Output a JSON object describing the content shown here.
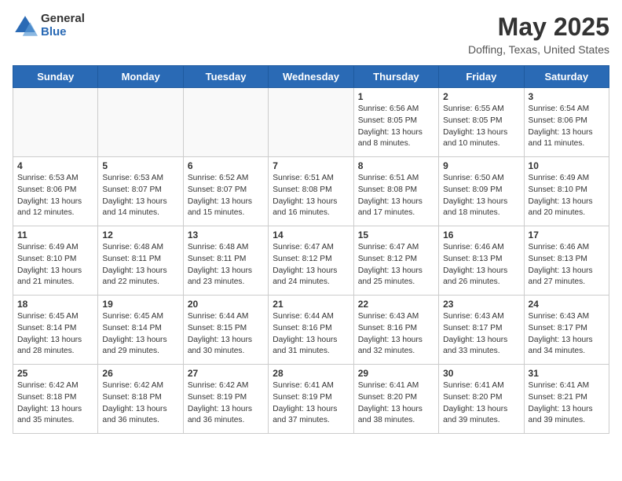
{
  "header": {
    "logo_general": "General",
    "logo_blue": "Blue",
    "month_year": "May 2025",
    "location": "Doffing, Texas, United States"
  },
  "days_of_week": [
    "Sunday",
    "Monday",
    "Tuesday",
    "Wednesday",
    "Thursday",
    "Friday",
    "Saturday"
  ],
  "weeks": [
    [
      {
        "day": "",
        "info": ""
      },
      {
        "day": "",
        "info": ""
      },
      {
        "day": "",
        "info": ""
      },
      {
        "day": "",
        "info": ""
      },
      {
        "day": "1",
        "info": "Sunrise: 6:56 AM\nSunset: 8:05 PM\nDaylight: 13 hours\nand 8 minutes."
      },
      {
        "day": "2",
        "info": "Sunrise: 6:55 AM\nSunset: 8:05 PM\nDaylight: 13 hours\nand 10 minutes."
      },
      {
        "day": "3",
        "info": "Sunrise: 6:54 AM\nSunset: 8:06 PM\nDaylight: 13 hours\nand 11 minutes."
      }
    ],
    [
      {
        "day": "4",
        "info": "Sunrise: 6:53 AM\nSunset: 8:06 PM\nDaylight: 13 hours\nand 12 minutes."
      },
      {
        "day": "5",
        "info": "Sunrise: 6:53 AM\nSunset: 8:07 PM\nDaylight: 13 hours\nand 14 minutes."
      },
      {
        "day": "6",
        "info": "Sunrise: 6:52 AM\nSunset: 8:07 PM\nDaylight: 13 hours\nand 15 minutes."
      },
      {
        "day": "7",
        "info": "Sunrise: 6:51 AM\nSunset: 8:08 PM\nDaylight: 13 hours\nand 16 minutes."
      },
      {
        "day": "8",
        "info": "Sunrise: 6:51 AM\nSunset: 8:08 PM\nDaylight: 13 hours\nand 17 minutes."
      },
      {
        "day": "9",
        "info": "Sunrise: 6:50 AM\nSunset: 8:09 PM\nDaylight: 13 hours\nand 18 minutes."
      },
      {
        "day": "10",
        "info": "Sunrise: 6:49 AM\nSunset: 8:10 PM\nDaylight: 13 hours\nand 20 minutes."
      }
    ],
    [
      {
        "day": "11",
        "info": "Sunrise: 6:49 AM\nSunset: 8:10 PM\nDaylight: 13 hours\nand 21 minutes."
      },
      {
        "day": "12",
        "info": "Sunrise: 6:48 AM\nSunset: 8:11 PM\nDaylight: 13 hours\nand 22 minutes."
      },
      {
        "day": "13",
        "info": "Sunrise: 6:48 AM\nSunset: 8:11 PM\nDaylight: 13 hours\nand 23 minutes."
      },
      {
        "day": "14",
        "info": "Sunrise: 6:47 AM\nSunset: 8:12 PM\nDaylight: 13 hours\nand 24 minutes."
      },
      {
        "day": "15",
        "info": "Sunrise: 6:47 AM\nSunset: 8:12 PM\nDaylight: 13 hours\nand 25 minutes."
      },
      {
        "day": "16",
        "info": "Sunrise: 6:46 AM\nSunset: 8:13 PM\nDaylight: 13 hours\nand 26 minutes."
      },
      {
        "day": "17",
        "info": "Sunrise: 6:46 AM\nSunset: 8:13 PM\nDaylight: 13 hours\nand 27 minutes."
      }
    ],
    [
      {
        "day": "18",
        "info": "Sunrise: 6:45 AM\nSunset: 8:14 PM\nDaylight: 13 hours\nand 28 minutes."
      },
      {
        "day": "19",
        "info": "Sunrise: 6:45 AM\nSunset: 8:14 PM\nDaylight: 13 hours\nand 29 minutes."
      },
      {
        "day": "20",
        "info": "Sunrise: 6:44 AM\nSunset: 8:15 PM\nDaylight: 13 hours\nand 30 minutes."
      },
      {
        "day": "21",
        "info": "Sunrise: 6:44 AM\nSunset: 8:16 PM\nDaylight: 13 hours\nand 31 minutes."
      },
      {
        "day": "22",
        "info": "Sunrise: 6:43 AM\nSunset: 8:16 PM\nDaylight: 13 hours\nand 32 minutes."
      },
      {
        "day": "23",
        "info": "Sunrise: 6:43 AM\nSunset: 8:17 PM\nDaylight: 13 hours\nand 33 minutes."
      },
      {
        "day": "24",
        "info": "Sunrise: 6:43 AM\nSunset: 8:17 PM\nDaylight: 13 hours\nand 34 minutes."
      }
    ],
    [
      {
        "day": "25",
        "info": "Sunrise: 6:42 AM\nSunset: 8:18 PM\nDaylight: 13 hours\nand 35 minutes."
      },
      {
        "day": "26",
        "info": "Sunrise: 6:42 AM\nSunset: 8:18 PM\nDaylight: 13 hours\nand 36 minutes."
      },
      {
        "day": "27",
        "info": "Sunrise: 6:42 AM\nSunset: 8:19 PM\nDaylight: 13 hours\nand 36 minutes."
      },
      {
        "day": "28",
        "info": "Sunrise: 6:41 AM\nSunset: 8:19 PM\nDaylight: 13 hours\nand 37 minutes."
      },
      {
        "day": "29",
        "info": "Sunrise: 6:41 AM\nSunset: 8:20 PM\nDaylight: 13 hours\nand 38 minutes."
      },
      {
        "day": "30",
        "info": "Sunrise: 6:41 AM\nSunset: 8:20 PM\nDaylight: 13 hours\nand 39 minutes."
      },
      {
        "day": "31",
        "info": "Sunrise: 6:41 AM\nSunset: 8:21 PM\nDaylight: 13 hours\nand 39 minutes."
      }
    ]
  ]
}
